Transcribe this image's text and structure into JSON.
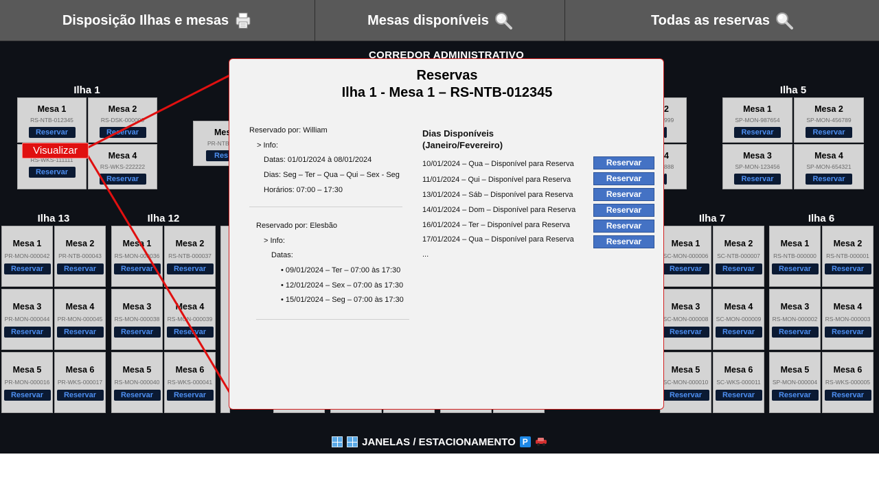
{
  "nav": {
    "tab1": "Disposição Ilhas e mesas",
    "tab2": "Mesas disponíveis",
    "tab3": "Todas as reservas"
  },
  "corridor": "CORREDOR ADMINISTRATIVO",
  "footer": "JANELAS / ESTACIONAMENTO",
  "reserve_label": "Reservar",
  "visualizar": "Visualizar",
  "islands": {
    "ilha1": "Ilha 1",
    "ilha5": "Ilha 5",
    "ilha13": "Ilha 13",
    "ilha12": "Ilha 12",
    "ilha7": "Ilha 7",
    "ilha6": "Ilha 6"
  },
  "desks": {
    "i1m1": {
      "name": "Mesa 1",
      "code": "RS-NTB-012345"
    },
    "i1m2": {
      "name": "Mesa 2",
      "code": "RS-DSK-000000"
    },
    "i1m3": {
      "name": "",
      "code": "RS-WKS-111111"
    },
    "i1m4": {
      "name": "Mesa 4",
      "code": "RS-WKS-222222"
    },
    "i2m1": {
      "name": "Mes",
      "code": "PR-NTB"
    },
    "i5m1": {
      "name": "Mesa 1",
      "code": "SP-MON-987654"
    },
    "i5m2": {
      "name": "Mesa 2",
      "code": "SP-MON-456789"
    },
    "i5m3": {
      "name": "Mesa 3",
      "code": "SP-MON-123456"
    },
    "i5m4": {
      "name": "Mesa 4",
      "code": "SP-MON-654321"
    },
    "i4m2": {
      "name": "2",
      "code": "999"
    },
    "i4m4": {
      "name": "4",
      "code": "888"
    },
    "i13m1": {
      "name": "Mesa 1",
      "code": "PR-MON-000042"
    },
    "i13m2": {
      "name": "Mesa 2",
      "code": "PR-NTB-000043"
    },
    "i13m3": {
      "name": "Mesa 3",
      "code": "PR-MON-000044"
    },
    "i13m4": {
      "name": "Mesa 4",
      "code": "PR-MON-000045"
    },
    "i13m5": {
      "name": "Mesa 5",
      "code": "PR-MON-000016"
    },
    "i13m6": {
      "name": "Mesa 6",
      "code": "PR-WKS-000017"
    },
    "i12m1": {
      "name": "Mesa 1",
      "code": "RS-MON-000036"
    },
    "i12m2": {
      "name": "Mesa 2",
      "code": "RS-NTB-000037"
    },
    "i12m3": {
      "name": "Mesa 3",
      "code": "RS-MON-000038"
    },
    "i12m4": {
      "name": "Mesa 4",
      "code": "RS-MON-000039"
    },
    "i12m5": {
      "name": "Mesa 5",
      "code": "RS-MON-000040"
    },
    "i12m6": {
      "name": "Mesa 6",
      "code": "RS-WKS-000041"
    },
    "i7m1": {
      "name": "Mesa 1",
      "code": "SC-MON-000006"
    },
    "i7m2": {
      "name": "Mesa 2",
      "code": "SC-NTB-000007"
    },
    "i7m3": {
      "name": "Mesa 3",
      "code": "SC-MON-000008"
    },
    "i7m4": {
      "name": "Mesa 4",
      "code": "SC-MON-000009"
    },
    "i7m5": {
      "name": "Mesa 5",
      "code": "SC-MON-000010"
    },
    "i7m6": {
      "name": "Mesa 6",
      "code": "SC-WKS-000011"
    },
    "i6m1": {
      "name": "Mesa 1",
      "code": "RS-NTB-000000"
    },
    "i6m2": {
      "name": "Mesa 2",
      "code": "RS-NTB-000001"
    },
    "i6m3": {
      "name": "Mesa 3",
      "code": "RS-MON-000002"
    },
    "i6m4": {
      "name": "Mesa 4",
      "code": "RS-MON-000003"
    },
    "i6m5": {
      "name": "Mesa 5",
      "code": "SP-MON-000004"
    },
    "i6m6": {
      "name": "Mesa 6",
      "code": "RS-WKS-000005"
    }
  },
  "modal": {
    "title": "Reservas",
    "subtitle": "Ilha 1 - Mesa 1 – RS-NTB-012345",
    "r1": {
      "by": "Reservado por: William",
      "info": ">  Info:",
      "dates": "Datas: 01/01/2024 à 08/01/2024",
      "days": "Dias: Seg – Ter – Qua – Qui – Sex - Seg",
      "hours": "Horários: 07:00 – 17:30"
    },
    "r2": {
      "by": "Reservado por: Elesbão",
      "info": ">  Info:",
      "dates_label": "Datas:",
      "d1": "• 09/01/2024 – Ter – 07:00 às 17:30",
      "d2": "• 12/01/2024 – Sex – 07:00 às 17:30",
      "d3": "• 15/01/2024 – Seg – 07:00 às 17:30"
    },
    "avail_title_1": "Dias Disponíveis",
    "avail_title_2": "(Janeiro/Fevereiro)",
    "avail": [
      "10/01/2024 – Qua   – Disponível para Reserva",
      "11/01/2024 – Qui    – Disponível para Reserva",
      "13/01/2024 – Sáb   – Disponível para Reserva",
      "14/01/2024 – Dom – Disponível para Reserva",
      "16/01/2024 – Ter    – Disponível para Reserva",
      "17/01/2024 – Qua   – Disponível para Reserva"
    ],
    "ellipsis": "...",
    "reserve_btn": "Reservar"
  },
  "colors": {
    "background": "#0e1117",
    "nav": "#595959",
    "desk": "#d4d4d4",
    "accent_red": "#e01010",
    "reserve_blue": "#4472c4"
  },
  "icons": [
    "printer-icon",
    "magnifier-icon",
    "window-icon",
    "parking-icon",
    "car-icon"
  ]
}
